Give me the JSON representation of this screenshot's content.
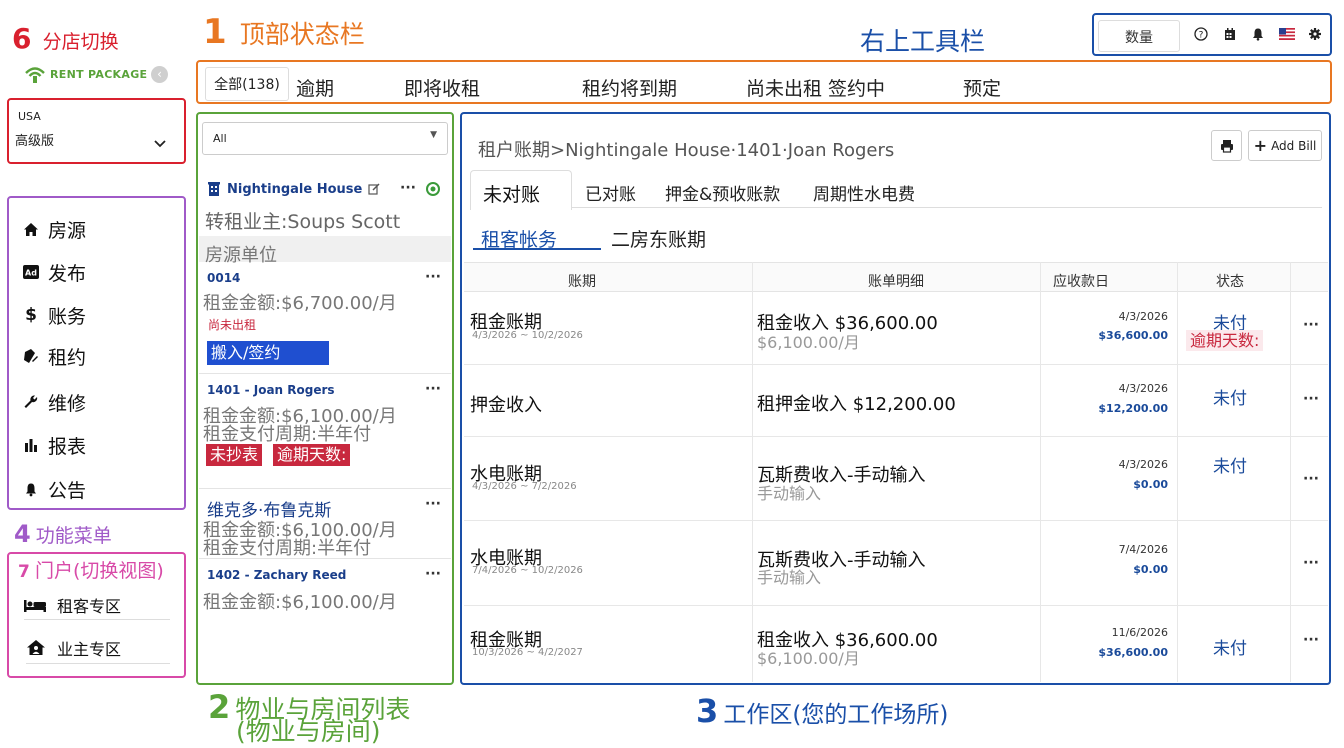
{
  "annotations": {
    "branch_switch": {
      "num": "6",
      "label": "分店切换"
    },
    "top_status_bar": {
      "num": "1",
      "label": "顶部状态栏"
    },
    "top_right_toolbar": {
      "label": "右上工具栏"
    },
    "function_menu": {
      "num": "4",
      "label": "功能菜单"
    },
    "portal": {
      "num": "7",
      "label": "门户(切换视图)"
    },
    "property_list": {
      "num": "2",
      "label": "物业与房间列表",
      "sub": "(物业与房间)"
    },
    "work_area": {
      "num": "3",
      "label": "工作区(您的工作场所)"
    }
  },
  "brand": {
    "logo_text": "RENT PACKAGE"
  },
  "branch": {
    "region": "USA",
    "edition": "高级版"
  },
  "status_tabs": [
    "全部(138)",
    "逾期",
    "即将收租",
    "租约将到期",
    "尚未出租 签约中",
    "预定"
  ],
  "toolbar": {
    "quantity_label": "数量",
    "icons": [
      "help-icon",
      "calendar-icon",
      "bell-icon",
      "us-flag-icon",
      "gear-icon"
    ]
  },
  "menu": [
    {
      "icon": "home-icon",
      "label": "房源"
    },
    {
      "icon": "ad-icon",
      "label": "发布"
    },
    {
      "icon": "dollar-icon",
      "label": "账务"
    },
    {
      "icon": "contract-icon",
      "label": "租约"
    },
    {
      "icon": "wrench-icon",
      "label": "维修"
    },
    {
      "icon": "bar-chart-icon",
      "label": "报表"
    },
    {
      "icon": "bell-icon",
      "label": "公告"
    }
  ],
  "portals": [
    {
      "icon": "bed-icon",
      "label": "租客专区"
    },
    {
      "icon": "owner-home-icon",
      "label": "业主专区"
    }
  ],
  "property_panel": {
    "filter_value": "All",
    "property_name": "Nightingale House",
    "sublease_owner": "转租业主:Soups Scott",
    "units_header": "房源单位",
    "units": [
      {
        "title": "0014",
        "rent": "租金金额:$6,700.00/月",
        "status": "尚未出租",
        "action": "搬入/签约"
      },
      {
        "title": "1401 - Joan Rogers",
        "rent": "租金金额:$6,100.00/月",
        "cycle": "租金支付周期:半年付",
        "tag1": "未抄表",
        "tag2": "逾期天数:"
      },
      {
        "title": "维克多·布鲁克斯",
        "rent": "租金金额:$6,100.00/月",
        "cycle": "租金支付周期:半年付"
      },
      {
        "title": "1402 - Zachary Reed",
        "rent": "租金金额:$6,100.00/月"
      }
    ]
  },
  "work": {
    "breadcrumb": "租户账期>Nightingale House·1401·Joan Rogers",
    "add_bill_label": "Add Bill",
    "tabs": [
      "未对账",
      "已对账",
      "押金&预收账款",
      "周期性水电费"
    ],
    "subtabs": [
      "租客帐务",
      "二房东账期"
    ],
    "columns": [
      "账期",
      "账单明细",
      "应收款日",
      "状态"
    ],
    "rows": [
      {
        "title": "租金账期",
        "range": "4/3/2026 ~ 10/2/2026",
        "detail": "租金收入 $36,600.00",
        "sub": "$6,100.00/月",
        "date": "4/3/2026",
        "amount": "$36,600.00",
        "status": "未付",
        "overdue": "逾期天数:"
      },
      {
        "title": "押金收入",
        "range": "",
        "detail": "租押金收入 $12,200.00",
        "sub": "",
        "date": "4/3/2026",
        "amount": "$12,200.00",
        "status": "未付"
      },
      {
        "title": "水电账期",
        "range": "4/3/2026 ~ 7/2/2026",
        "detail": "瓦斯费收入-手动输入",
        "sub": "手动输入",
        "date": "4/3/2026",
        "amount": "$0.00",
        "status": "未付"
      },
      {
        "title": "水电账期",
        "range": "7/4/2026 ~ 10/2/2026",
        "detail": "瓦斯费收入-手动输入",
        "sub": "手动输入",
        "date": "7/4/2026",
        "amount": "$0.00",
        "status": ""
      },
      {
        "title": "租金账期",
        "range": "10/3/2026 ~ 4/2/2027",
        "detail": "租金收入 $36,600.00",
        "sub": "$6,100.00/月",
        "date": "11/6/2026",
        "amount": "$36,600.00",
        "status": "未付"
      }
    ]
  },
  "colors": {
    "orange": "#e87722",
    "red": "#d9202e",
    "purple": "#a05ac8",
    "pink": "#d84aa8",
    "green": "#5aa33a",
    "blue": "#1a4fa8",
    "tag_red": "#c8283e",
    "btn_blue": "#1f4fd0"
  }
}
